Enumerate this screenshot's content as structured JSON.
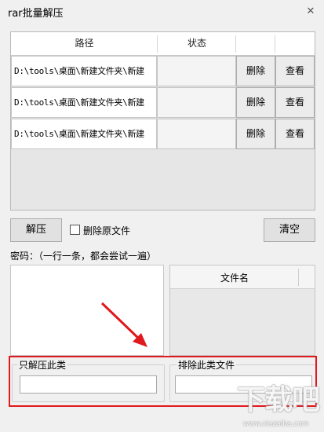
{
  "window": {
    "title": "rar批量解压",
    "close_glyph": "✕"
  },
  "grid": {
    "col_path": "路径",
    "col_status": "状态",
    "rows": [
      {
        "path": "D:\\tools\\桌面\\新建文件夹\\新建",
        "status": "",
        "delete_label": "删除",
        "view_label": "查看"
      },
      {
        "path": "D:\\tools\\桌面\\新建文件夹\\新建",
        "status": "",
        "delete_label": "删除",
        "view_label": "查看"
      },
      {
        "path": "D:\\tools\\桌面\\新建文件夹\\新建",
        "status": "",
        "delete_label": "删除",
        "view_label": "查看"
      }
    ]
  },
  "actions": {
    "extract_label": "解压",
    "delete_original_label": "删除原文件",
    "delete_original_checked": false,
    "clear_label": "清空"
  },
  "password": {
    "label": "密码：（一行一条，都会尝试一遍）",
    "value": ""
  },
  "file_list": {
    "col_filename": "文件名"
  },
  "filters": {
    "only_extract_label": "只解压此类",
    "only_extract_value": "",
    "exclude_label": "排除此类文件",
    "exclude_value": ""
  },
  "watermark": {
    "logo_text": "下载吧",
    "url": "www.xiazaiba.com"
  },
  "colors": {
    "highlight_box": "#e0191e",
    "arrow": "#e0191e"
  }
}
